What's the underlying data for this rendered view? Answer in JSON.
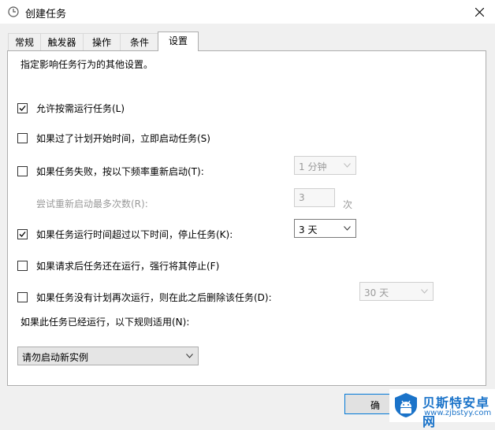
{
  "window": {
    "title": "创建任务"
  },
  "tabs": [
    {
      "label": "常规"
    },
    {
      "label": "触发器"
    },
    {
      "label": "操作"
    },
    {
      "label": "条件"
    },
    {
      "label": "设置",
      "active": true
    }
  ],
  "settings": {
    "description": "指定影响任务行为的其他设置。",
    "allow_on_demand": {
      "label": "允许按需运行任务(L)",
      "checked": true
    },
    "start_if_missed": {
      "label": "如果过了计划开始时间，立即启动任务(S)",
      "checked": false
    },
    "restart_on_failure": {
      "label": "如果任务失败，按以下频率重新启动(T):",
      "checked": false,
      "interval": "1 分钟"
    },
    "restart_attempts": {
      "label": "尝试重新启动最多次数(R):",
      "value": "3",
      "unit": "次"
    },
    "stop_if_longer": {
      "label": "如果任务运行时间超过以下时间，停止任务(K):",
      "checked": true,
      "duration": "3 天"
    },
    "force_stop": {
      "label": "如果请求后任务还在运行，强行将其停止(F)",
      "checked": false
    },
    "delete_if_not_scheduled": {
      "label": "如果任务没有计划再次运行，则在此之后删除该任务(D):",
      "checked": false,
      "after": "30 天"
    },
    "rule_label": "如果此任务已经运行，以下规则适用(N):",
    "rule_value": "请勿启动新实例"
  },
  "buttons": {
    "ok_label": "确"
  },
  "watermark": {
    "text": "贝斯特安卓网",
    "url": "www.zjbstyy.com"
  },
  "colors": {
    "accent": "#0078d7",
    "watermark": "#1a73c9"
  }
}
